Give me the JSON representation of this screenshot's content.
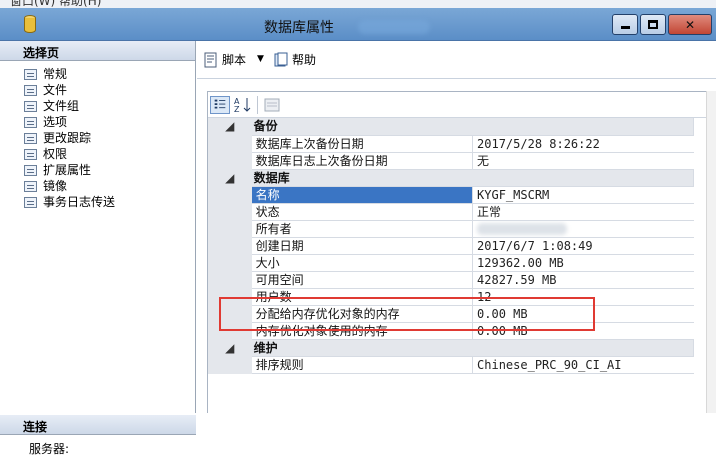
{
  "window": {
    "top_strip_text": "窗口(W)    帮助(H)",
    "title": "数据库属性",
    "controls": {
      "minimize": "minimize",
      "maximize": "maximize",
      "close": "✕"
    }
  },
  "left_pane": {
    "header": "选择页",
    "pages": [
      "常规",
      "文件",
      "文件组",
      "选项",
      "更改跟踪",
      "权限",
      "扩展属性",
      "镜像",
      "事务日志传送"
    ],
    "connection_header": "连接",
    "server_label": "服务器:"
  },
  "toolbar": {
    "script_label": "脚本",
    "help_label": "帮助"
  },
  "grid": {
    "categories": [
      {
        "name": "备份",
        "rows": [
          {
            "name": "数据库上次备份日期",
            "value": "2017/5/28 8:26:22"
          },
          {
            "name": "数据库日志上次备份日期",
            "value": "无"
          }
        ]
      },
      {
        "name": "数据库",
        "rows": [
          {
            "name": "名称",
            "value": "KYGF_MSCRM",
            "selected": true
          },
          {
            "name": "状态",
            "value": "正常"
          },
          {
            "name": "所有者",
            "value": ""
          },
          {
            "name": "创建日期",
            "value": "2017/6/7 1:08:49"
          },
          {
            "name": "大小",
            "value": "129362.00 MB"
          },
          {
            "name": "可用空间",
            "value": "42827.59 MB"
          },
          {
            "name": "用户数",
            "value": "12"
          },
          {
            "name": "分配给内存优化对象的内存",
            "value": "0.00 MB"
          },
          {
            "name": "内存优化对象使用的内存",
            "value": "0.00 MB"
          }
        ]
      },
      {
        "name": "维护",
        "rows": [
          {
            "name": "排序规则",
            "value": "Chinese_PRC_90_CI_AI"
          }
        ]
      }
    ]
  },
  "colors": {
    "selection": "#3a75c4",
    "highlight_box": "#e03a33",
    "titlebar": "#6a9ad0"
  }
}
